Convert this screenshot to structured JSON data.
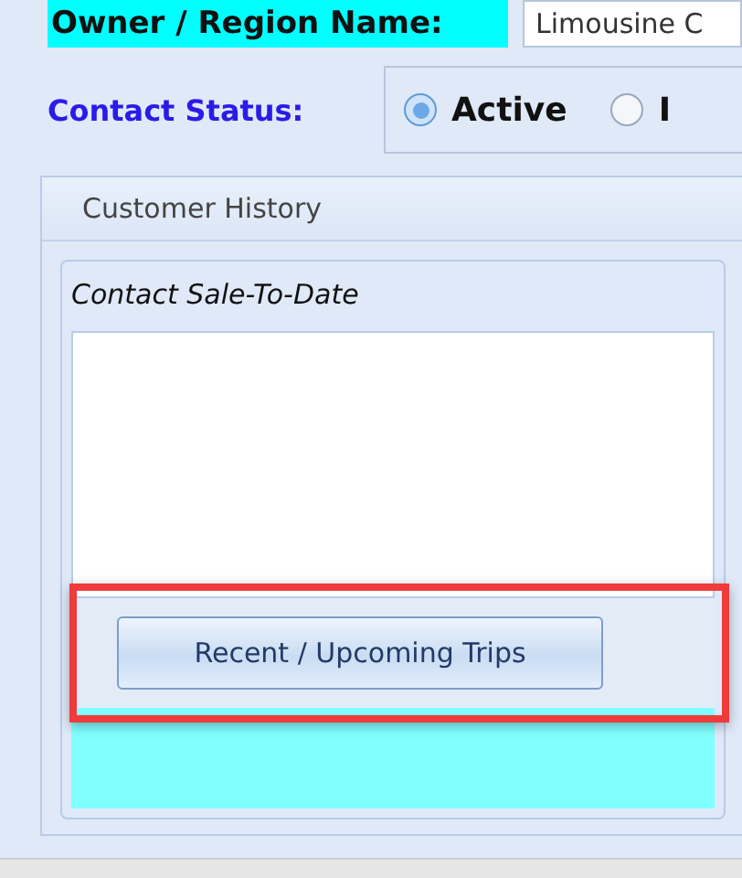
{
  "owner_field": {
    "label": "Owner / Region Name:",
    "value": "Limousine C"
  },
  "contact_status": {
    "label": "Contact Status:",
    "options": [
      {
        "label": "Active",
        "selected": true
      },
      {
        "label": "I",
        "selected": false
      }
    ]
  },
  "group": {
    "title": "Customer History",
    "panel": {
      "title": "Contact Sale-To-Date",
      "button": "Recent / Upcoming Trips",
      "highlighted": true
    }
  }
}
